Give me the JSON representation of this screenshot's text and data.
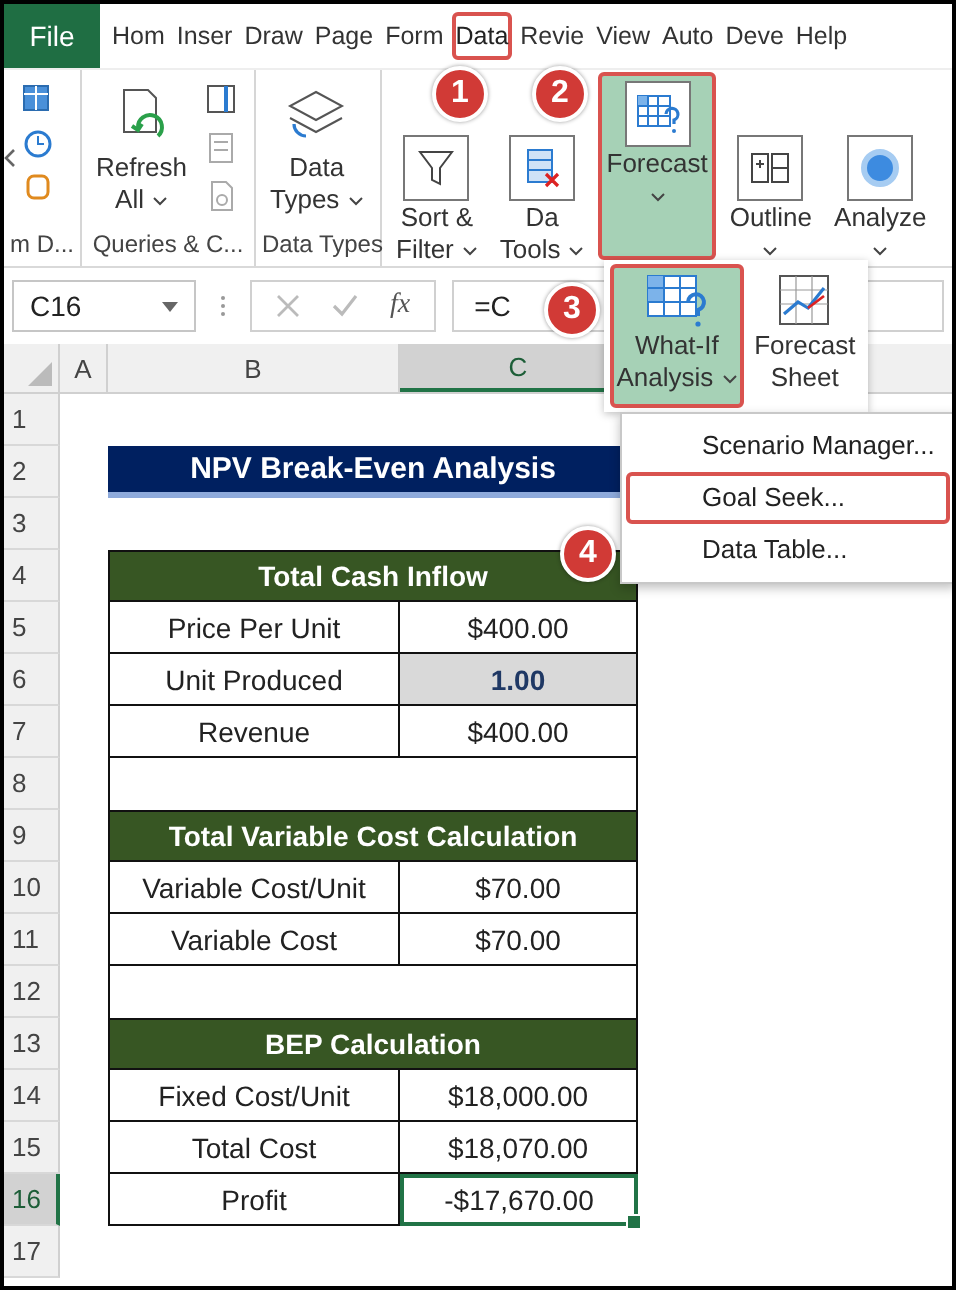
{
  "ribbon_tabs": [
    {
      "label": "File",
      "kind": "file",
      "selected": false
    },
    {
      "label": "Hom",
      "kind": "tab",
      "selected": false
    },
    {
      "label": "Inser",
      "kind": "tab",
      "selected": false
    },
    {
      "label": "Draw",
      "kind": "tab",
      "selected": false
    },
    {
      "label": "Page",
      "kind": "tab",
      "selected": false
    },
    {
      "label": "Form",
      "kind": "tab",
      "selected": false
    },
    {
      "label": "Data",
      "kind": "tab",
      "selected": true
    },
    {
      "label": "Revie",
      "kind": "tab",
      "selected": false
    },
    {
      "label": "View",
      "kind": "tab",
      "selected": false
    },
    {
      "label": "Auto",
      "kind": "tab",
      "selected": false
    },
    {
      "label": "Deve",
      "kind": "tab",
      "selected": false
    },
    {
      "label": "Help",
      "kind": "tab",
      "selected": false
    }
  ],
  "ribbon_groups": [
    {
      "kind": "partial",
      "label": "m D..."
    },
    {
      "kind": "queries",
      "label": "Queries & C...",
      "buttons": [
        {
          "kind": "refresh",
          "lines": [
            "Refresh",
            "All"
          ],
          "dropdown": true,
          "selected": false
        }
      ]
    },
    {
      "kind": "datatypes",
      "label": "Data Types",
      "buttons": [
        {
          "kind": "datatypes",
          "lines": [
            "Data",
            "Types"
          ],
          "dropdown": true,
          "selected": false
        }
      ]
    },
    {
      "kind": "tools",
      "buttons": [
        {
          "kind": "sort_filter",
          "lines": [
            "Sort &",
            "Filter"
          ],
          "dropdown": true,
          "selected": false
        },
        {
          "kind": "data_tools",
          "lines": [
            "Da",
            "Tools"
          ],
          "dropdown": true,
          "selected": false
        },
        {
          "kind": "forecast",
          "lines": [
            "Forecast"
          ],
          "dropdown": true,
          "selected": true
        },
        {
          "kind": "outline",
          "lines": [
            "Outline"
          ],
          "dropdown": true,
          "selected": false
        },
        {
          "kind": "analyze",
          "lines": [
            "Analyze"
          ],
          "dropdown": true,
          "selected": false
        }
      ]
    }
  ],
  "formula_bar": {
    "name_box": "C16",
    "function_label": "fx",
    "formula": "=C"
  },
  "columns": [
    {
      "label": "A",
      "selected": false
    },
    {
      "label": "B",
      "selected": false
    },
    {
      "label": "C",
      "selected": true
    }
  ],
  "rows": [
    {
      "number": "1",
      "kind": "blank",
      "selected": false
    },
    {
      "number": "2",
      "kind": "title",
      "text": "NPV Break-Even Analysis",
      "selected": false
    },
    {
      "number": "3",
      "kind": "blank",
      "selected": false
    },
    {
      "number": "4",
      "kind": "header",
      "text": "Total Cash Inflow",
      "selected": false
    },
    {
      "number": "5",
      "kind": "pair",
      "label": "Price Per Unit",
      "value": "$400.00",
      "highlighted": false,
      "selected": false
    },
    {
      "number": "6",
      "kind": "pair",
      "label": "Unit Produced",
      "value": "1.00",
      "highlighted": true,
      "selected": false
    },
    {
      "number": "7",
      "kind": "pair",
      "label": "Revenue",
      "value": "$400.00",
      "highlighted": false,
      "selected": false
    },
    {
      "number": "8",
      "kind": "gap",
      "selected": false
    },
    {
      "number": "9",
      "kind": "header",
      "text": "Total Variable Cost Calculation",
      "selected": false
    },
    {
      "number": "10",
      "kind": "pair",
      "label": "Variable Cost/Unit",
      "value": "$70.00",
      "highlighted": false,
      "selected": false
    },
    {
      "number": "11",
      "kind": "pair",
      "label": "Variable Cost",
      "value": "$70.00",
      "highlighted": false,
      "selected": false
    },
    {
      "number": "12",
      "kind": "gap",
      "selected": false
    },
    {
      "number": "13",
      "kind": "header",
      "text": "BEP Calculation",
      "selected": false
    },
    {
      "number": "14",
      "kind": "pair",
      "label": "Fixed Cost/Unit",
      "value": "$18,000.00",
      "highlighted": false,
      "selected": false
    },
    {
      "number": "15",
      "kind": "pair",
      "label": "Total Cost",
      "value": "$18,070.00",
      "highlighted": false,
      "selected": false
    },
    {
      "number": "16",
      "kind": "pair",
      "label": "Profit",
      "value": "-$17,670.00",
      "highlighted": false,
      "selected": true
    },
    {
      "number": "17",
      "kind": "blank",
      "selected": false
    }
  ],
  "forecast_menu": {
    "buttons": [
      {
        "kind": "what_if",
        "lines": [
          "What-If",
          "Analysis"
        ],
        "dropdown": true,
        "selected": true
      },
      {
        "kind": "forecast_sheet",
        "lines": [
          "Forecast",
          "Sheet"
        ],
        "dropdown": false,
        "selected": false
      }
    ],
    "items": [
      {
        "label": "Scenario Manager...",
        "selected": false
      },
      {
        "label": "Goal Seek...",
        "selected": true
      },
      {
        "label": "Data Table...",
        "selected": false
      }
    ]
  },
  "step_badges": [
    {
      "label": "1"
    },
    {
      "label": "2"
    },
    {
      "label": "3"
    },
    {
      "label": "4"
    }
  ]
}
